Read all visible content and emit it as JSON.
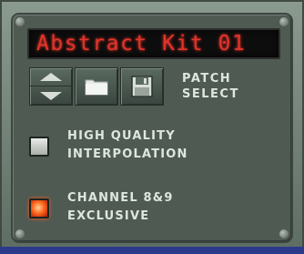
{
  "patch_display": {
    "text": "Abstract Kit 01"
  },
  "patch_buttons": {
    "prev_icon": "arrow-up",
    "next_icon": "arrow-down",
    "browse_icon": "folder",
    "save_icon": "floppy-disk"
  },
  "patch_select": {
    "line1": "PATCH",
    "line2": "SELECT"
  },
  "high_quality": {
    "line1": "HIGH QUALITY",
    "line2": "INTERPOLATION",
    "state": "off"
  },
  "channel_exclusive": {
    "line1": "CHANNEL 8&9",
    "line2": "EXCLUSIVE",
    "state": "on"
  },
  "colors": {
    "panel": "#4e5a52",
    "display_bg": "#0e0d0d",
    "display_text": "#e0342c",
    "label_text": "#dfe5df",
    "led_on": "#ff6a1e"
  }
}
